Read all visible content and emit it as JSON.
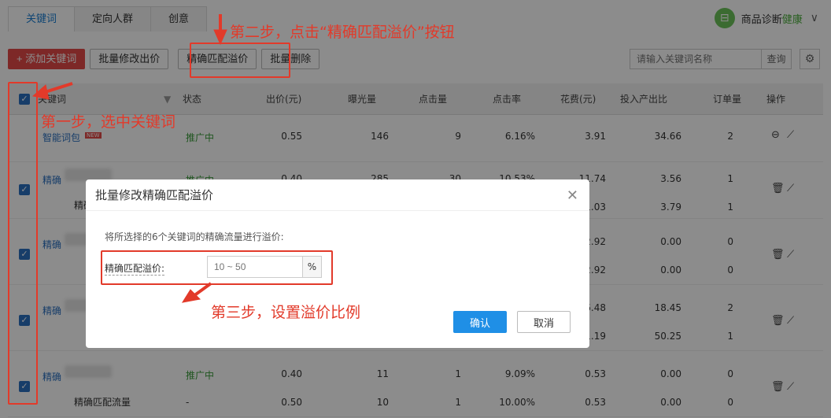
{
  "tabs": [
    {
      "label": "关键词"
    },
    {
      "label": "定向人群"
    },
    {
      "label": "创意"
    }
  ],
  "health": {
    "label": "商品诊断",
    "status": "健康"
  },
  "toolbar": {
    "add_keyword": "+ 添加关键词",
    "batch_edit_bid": "批量修改出价",
    "exact_premium": "精确匹配溢价",
    "batch_delete": "批量删除"
  },
  "search": {
    "placeholder": "请输入关键词名称",
    "button": "查询"
  },
  "table": {
    "headers": [
      "关键词",
      "状态",
      "出价(元)",
      "曝光量",
      "点击量",
      "点击率",
      "花费(元)",
      "投入产出比",
      "订单量",
      "操作"
    ],
    "rows": [
      {
        "keyword": "智能词包",
        "badge": "NEW",
        "status": "推广中",
        "bid": "0.55",
        "impressions": "146",
        "clicks": "9",
        "ctr": "6.16%",
        "cost": "3.91",
        "roi": "34.66",
        "orders": "2"
      },
      {
        "keyword": "精确",
        "status": "推广中",
        "bid": "0.40",
        "impressions": "285",
        "clicks": "30",
        "ctr": "10.53%",
        "cost": "11.74",
        "roi": "3.56",
        "orders": "1"
      },
      {
        "keyword": "精确",
        "sub_label": "精确",
        "cost2": "1.03",
        "roi2": "3.79",
        "orders2": "1"
      },
      {
        "keyword": "精确",
        "cost": "2.92",
        "roi": "0.00",
        "orders": "0",
        "cost2": "2.92",
        "roi2": "0.00",
        "orders2": "0"
      },
      {
        "keyword": "精确",
        "cost": "6.48",
        "roi": "18.45",
        "orders": "2",
        "cost2": "1.19",
        "roi2": "50.25",
        "orders2": "1"
      },
      {
        "keyword": "精确",
        "status": "推广中",
        "bid": "0.40",
        "impressions": "11",
        "clicks": "1",
        "ctr": "9.09%",
        "cost": "0.53",
        "roi": "0.00",
        "orders": "0",
        "sub_label": "精确匹配流量",
        "status2": "-",
        "bid2": "0.50",
        "impressions2": "10",
        "clicks2": "1",
        "ctr2": "10.00%",
        "cost2": "0.53",
        "roi2": "0.00",
        "orders2": "0"
      }
    ]
  },
  "dialog": {
    "title": "批量修改精确匹配溢价",
    "description": "将所选择的6个关键词的精确流量进行溢价:",
    "field_label": "精确匹配溢价:",
    "input_placeholder": "10 ~ 50",
    "unit": "%",
    "confirm": "确认",
    "cancel": "取消"
  },
  "annotations": {
    "step1": "第一步，选中关键词",
    "step2": "第二步，点击“精确匹配溢价”按钮",
    "step3": "第三步，设置溢价比例"
  },
  "colors": {
    "annotation": "#e23a2a",
    "primary": "#1f8fe6",
    "add": "#e34a47"
  }
}
